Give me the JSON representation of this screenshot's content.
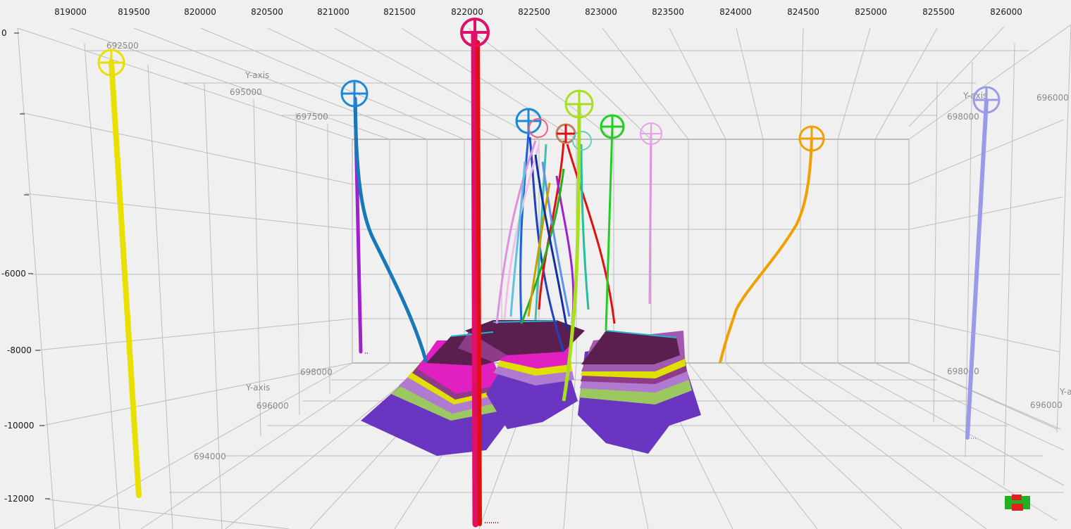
{
  "view": {
    "x_axis_ticks": [
      "819000",
      "819500",
      "820000",
      "820500",
      "821000",
      "821500",
      "822000",
      "822500",
      "823000",
      "823500",
      "824000",
      "824500",
      "825000",
      "825500",
      "826000"
    ],
    "z_axis_ticks": [
      "0",
      "-6000",
      "-8000",
      "-10000",
      "-12000"
    ],
    "y_axis_name": "Y-axis",
    "y_axis_name_cut": "Y-a",
    "y_back_left_ticks": [
      "692500",
      "695000",
      "697500"
    ],
    "y_back_right_ticks": [
      "696000",
      "698000"
    ],
    "y_floor_left_ticks": [
      "698000",
      "696000",
      "694000"
    ],
    "y_floor_right_ticks": [
      "698000",
      "696000"
    ]
  },
  "colors": {
    "background": "#f0f0f0",
    "grid": "#bdbdbd",
    "horizon_base": "#6a35c0",
    "horizon_bands": [
      "#5a1f4e",
      "#8e3c8a",
      "#e0e000",
      "#e020c0",
      "#b07ad0",
      "#9cc860",
      "#6a35c0"
    ]
  },
  "wells": [
    {
      "name": "yellow-well",
      "color": "#e8e000"
    },
    {
      "name": "violet-well",
      "color": "#a020d0"
    },
    {
      "name": "blue-well",
      "color": "#1a8ad8"
    },
    {
      "name": "magenta-well",
      "color": "#e0106a"
    },
    {
      "name": "lime-well",
      "color": "#a8e020"
    },
    {
      "name": "green-well",
      "color": "#20d020"
    },
    {
      "name": "pink-well",
      "color": "#e090e0"
    },
    {
      "name": "orange-well",
      "color": "#f0a000"
    },
    {
      "name": "lavender-well",
      "color": "#9a9ae8"
    },
    {
      "name": "red-well",
      "color": "#e01010"
    }
  ],
  "orientation_widget": {
    "icon": "view-cube-icon",
    "colors": [
      "#20b020",
      "#e02020"
    ]
  }
}
